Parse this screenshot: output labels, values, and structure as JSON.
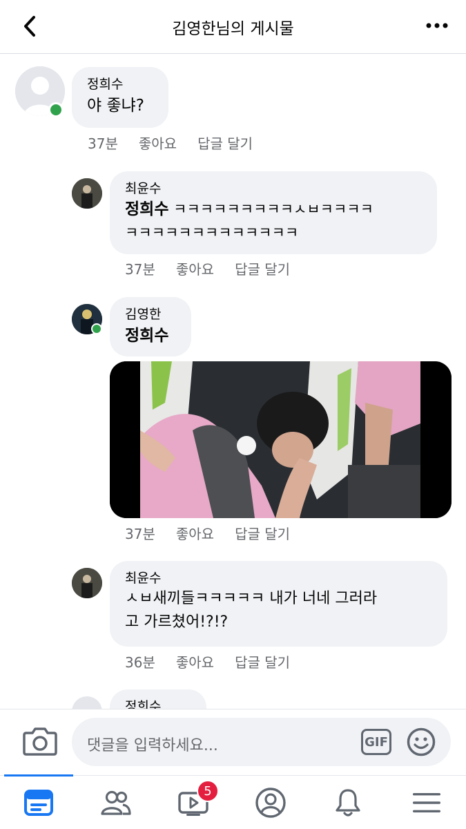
{
  "header": {
    "title": "김영한님의 게시물"
  },
  "comments": [
    {
      "author": "정희수",
      "text": "야 좋냐?",
      "time": "37분",
      "like": "좋아요",
      "reply": "답글 달기"
    },
    {
      "author": "최윤수",
      "mention": "정희수",
      "text_line1": " ㅋㅋㅋㅋㅋㅋㅋㅋㅋㅅㅂㅋㅋㅋㅋ",
      "text_line2": "ㅋㅋㅋㅋㅋㅋㅋㅋㅋㅋㅋㅋㅋ",
      "time": "37분",
      "like": "좋아요",
      "reply": "답글 달기"
    },
    {
      "author": "김영한",
      "mention": "정희수",
      "time": "37분",
      "like": "좋아요",
      "reply": "답글 달기"
    },
    {
      "author": "최윤수",
      "text_line1": "ㅅㅂ새끼들ㅋㅋㅋㅋㅋ 내가 너네 그러라",
      "text_line2": "고 가르쳤어!?!?",
      "time": "36분",
      "like": "좋아요",
      "reply": "답글 달기"
    },
    {
      "author": "정희수"
    }
  ],
  "composer": {
    "placeholder": "댓글을 입력하세요...",
    "gif_label": "GIF"
  },
  "tabbar": {
    "watch_badge": "5",
    "active_tab": "news-feed"
  },
  "icons": {
    "back": "chevron-left-icon",
    "more": "more-dots-icon",
    "camera": "camera-icon",
    "sticker": "smiley-icon",
    "tabs": [
      "news-feed-icon",
      "friends-icon",
      "watch-icon",
      "profile-icon",
      "notifications-icon",
      "menu-icon"
    ]
  },
  "colors": {
    "accent": "#1877f2",
    "online": "#31a24c",
    "badge": "#e41e3f",
    "bubble": "#f0f2f5",
    "meta_text": "#65676b"
  }
}
